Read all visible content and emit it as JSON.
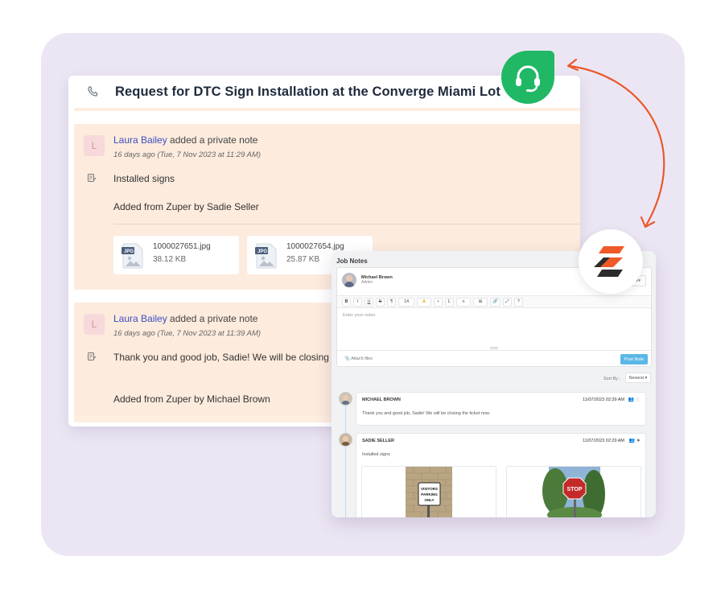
{
  "ticket": {
    "title": "Request for DTC Sign Installation at the Converge Miami Lot",
    "notes": [
      {
        "avatar_initial": "L",
        "author": "Laura Bailey",
        "action": " added a private note",
        "time": "16 days ago (Tue, 7 Nov 2023 at 11:29 AM)",
        "body": "Installed signs",
        "source": "Added from Zuper by Sadie Seller",
        "attachments": [
          {
            "name": "1000027651.jpg",
            "size": "38.12 KB",
            "type": "JPG"
          },
          {
            "name": "1000027654.jpg",
            "size": "25.87 KB",
            "type": "JPG"
          }
        ]
      },
      {
        "avatar_initial": "L",
        "author": "Laura Bailey",
        "action": " added a private note",
        "time": "16 days ago (Tue, 7 Nov 2023 at 11:39 AM)",
        "body": "Thank you and good job, Sadie! We will be closing the ti",
        "source": "Added from Zuper by Michael Brown"
      }
    ]
  },
  "job_notes": {
    "title": "Job Notes",
    "editor": {
      "user_name": "Michael Brown",
      "user_role": "Admin",
      "visibility": "All",
      "toolbar": [
        "B",
        "I",
        "U",
        "S",
        "¶",
        "14",
        "A",
        "•",
        "1.",
        "≡",
        "⊞",
        "🔗",
        "⤢",
        "?"
      ],
      "placeholder": "Enter your notes",
      "attach_label": "Attach files",
      "post_label": "Post Note"
    },
    "sort_label": "Sort By :",
    "sort_value": "Newest",
    "comments": [
      {
        "name": "MICHAEL BROWN",
        "date": "11/07/2023 02:39 AM",
        "text": "Thank you and good job, Sadie! We will be closing the ticket now."
      },
      {
        "name": "SADIE SELLER",
        "date": "11/07/2023 02:29 AM",
        "text": "Installed signs",
        "photos": [
          {
            "sign_lines": [
              "VISITORS",
              "PARKING",
              "ONLY"
            ]
          },
          {
            "sign_lines": [
              "STOP"
            ]
          }
        ]
      }
    ]
  },
  "colors": {
    "stage_bg": "#ece6f4",
    "note_bg": "#fdebdd",
    "link": "#3a4fc2",
    "support_green": "#20b865",
    "arrow_orange": "#e9592b",
    "post_button": "#5bb8e6"
  },
  "icons": {
    "support_badge": "headset-icon",
    "zuper_badge": "zuper-logo-icon",
    "ticket_type": "phone-icon",
    "note_type": "note-edit-icon"
  }
}
